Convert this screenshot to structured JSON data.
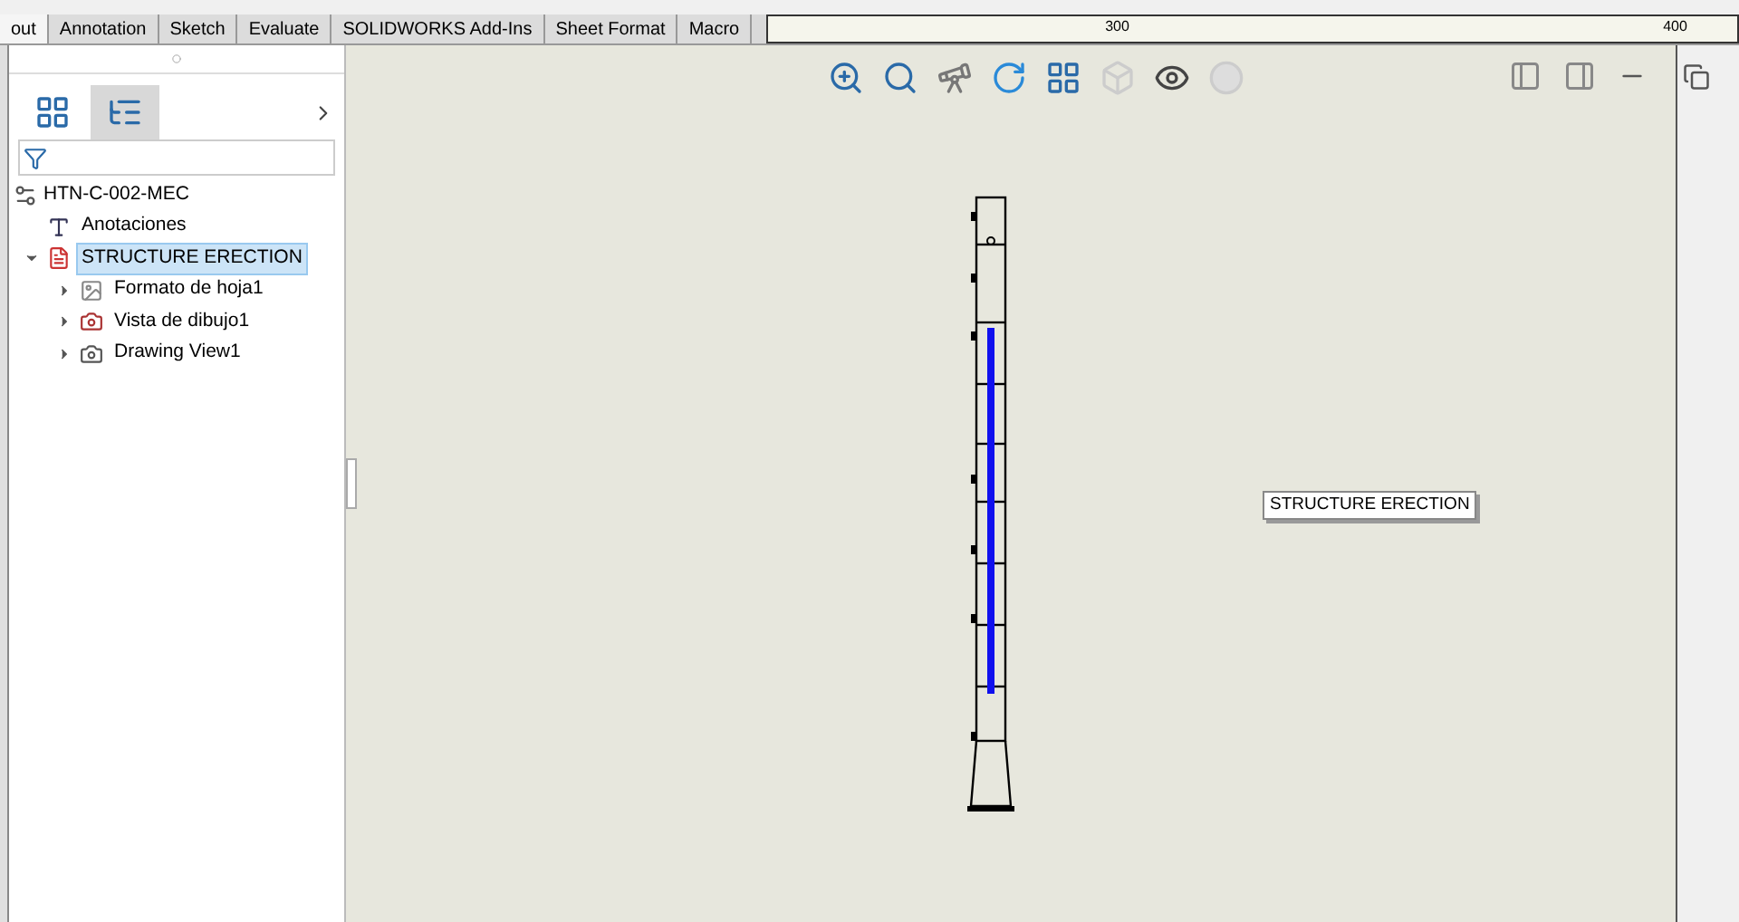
{
  "tabs": [
    {
      "label": "out",
      "selected": true
    },
    {
      "label": "Annotation",
      "selected": false
    },
    {
      "label": "Sketch",
      "selected": false
    },
    {
      "label": "Evaluate",
      "selected": false
    },
    {
      "label": "SOLIDWORKS Add-Ins",
      "selected": false
    },
    {
      "label": "Sheet Format",
      "selected": false
    },
    {
      "label": "Macro",
      "selected": false
    }
  ],
  "ruler": {
    "labels": [
      "300",
      "400"
    ]
  },
  "panel": {
    "tabs": [
      {
        "kind": "property",
        "selected": false
      },
      {
        "kind": "tree",
        "selected": true
      }
    ],
    "tree": {
      "label": "HTN-C-002-MEC",
      "children": [
        {
          "label": "Anotaciones",
          "kind": "annotation"
        },
        {
          "label": "STRUCTURE ERECTION",
          "kind": "sheet",
          "selected": true,
          "expanded": true,
          "children": [
            {
              "label": "Formato de hoja1",
              "kind": "format",
              "expanded": false
            },
            {
              "label": "Vista de dibujo1",
              "kind": "view",
              "expanded": false
            },
            {
              "label": "Drawing View1",
              "kind": "view2",
              "expanded": false
            }
          ]
        }
      ]
    }
  },
  "tooltip": "STRUCTURE ERECTION"
}
